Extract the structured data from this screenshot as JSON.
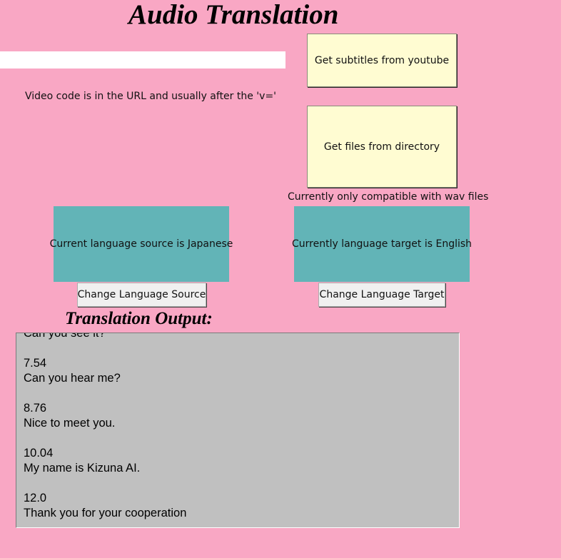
{
  "title": "Audio Translation",
  "url_input": {
    "value": "",
    "placeholder": ""
  },
  "buttons": {
    "youtube": "Get subtitles from youtube",
    "directory": "Get files from directory",
    "change_source": "Change Language Source",
    "change_target": "Change Language Target"
  },
  "hints": {
    "video_code": "Video code is in the URL and usually after the 'v='",
    "wav_only": "Currently only compatible with wav files"
  },
  "language": {
    "source_label": "Current language source is Japanese",
    "target_label": "Currently language target is English"
  },
  "output": {
    "label": "Translation Output:",
    "entries": [
      {
        "time": "",
        "text": "Can you see it?"
      },
      {
        "time": "7.54",
        "text": "Can you hear me?"
      },
      {
        "time": "8.76",
        "text": "Nice to meet you."
      },
      {
        "time": "10.04",
        "text": "My name is Kizuna AI."
      },
      {
        "time": "12.0",
        "text": "Thank you for your cooperation"
      }
    ]
  },
  "colors": {
    "background": "#f9a7c4",
    "yellow_button": "#fffcd2",
    "language_box": "#62b4b7",
    "output_box": "#c0c0c0"
  }
}
